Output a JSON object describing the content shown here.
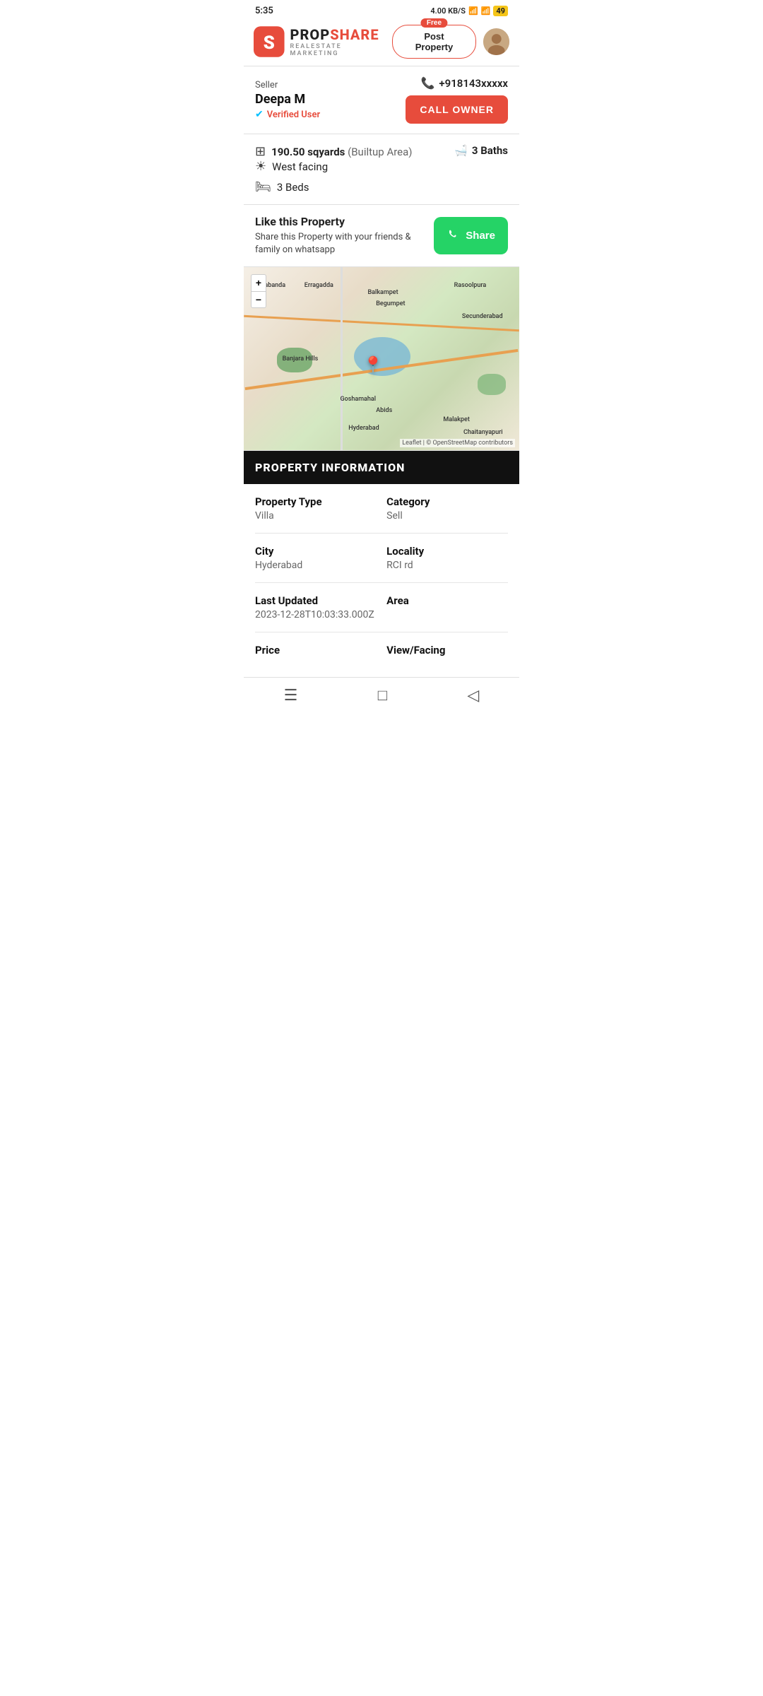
{
  "statusBar": {
    "time": "5:35",
    "network": "4.00 KB/S",
    "battery": "49"
  },
  "header": {
    "logoTextProp": "PROP",
    "logoTextShare": "SHARE",
    "logoSubtitle": "REALESTATE MARKETING",
    "freeBadge": "Free",
    "postPropertyLabel": "Post Property",
    "avatarAlt": "user avatar"
  },
  "seller": {
    "label": "Seller",
    "name": "Deepa M",
    "verifiedText": "Verified User",
    "phone": "+918143xxxxx",
    "callButtonLabel": "CALL OWNER"
  },
  "propertyDetails": {
    "area": "190.50 sqyards",
    "areaType": "(Builtup Area)",
    "facing": "West facing",
    "beds": "3 Beds",
    "baths": "3 Baths"
  },
  "shareSection": {
    "title": "Like this Property",
    "description": "Share this Property with your friends & family on whatsapp",
    "shareButtonLabel": "Share"
  },
  "map": {
    "attribution": "Leaflet | © OpenStreetMap contributors",
    "labels": [
      "Borabanda",
      "Erragadda",
      "Balkampet",
      "Rasoolpura",
      "Secunderabad",
      "Begumpet",
      "Banjara Hills",
      "Hyderabad",
      "Abids",
      "Goshamahal",
      "Malakpet",
      "Chaitanyapuri"
    ],
    "zoomIn": "+",
    "zoomOut": "−"
  },
  "propertyInfo": {
    "sectionTitle": "PROPERTY INFORMATION",
    "fields": [
      {
        "label": "Property Type",
        "value": "Villa",
        "labelRight": "Category",
        "valueRight": "Sell"
      },
      {
        "label": "City",
        "value": "Hyderabad",
        "labelRight": "Locality",
        "valueRight": "RCI rd"
      },
      {
        "label": "Last Updated",
        "value": "2023-12-28T10:03:33.000Z",
        "labelRight": "Area",
        "valueRight": ""
      },
      {
        "label": "Price",
        "value": "",
        "labelRight": "View/Facing",
        "valueRight": ""
      }
    ]
  },
  "bottomNav": {
    "menuIcon": "☰",
    "homeIcon": "□",
    "backIcon": "◁"
  }
}
